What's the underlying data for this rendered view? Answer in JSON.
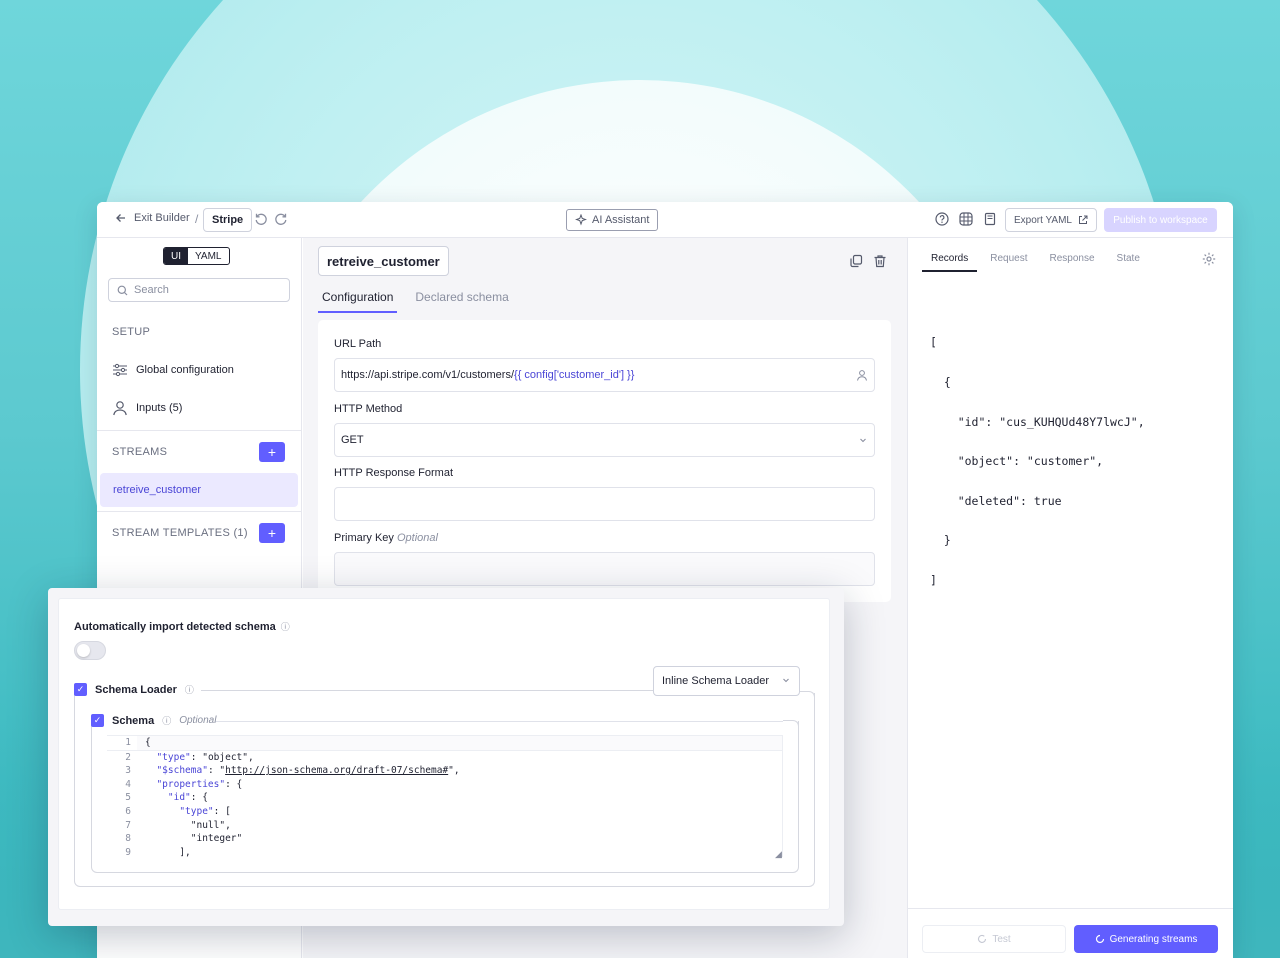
{
  "topbar": {
    "exit_label": "Exit Builder",
    "separator": "/",
    "connector_name": "Stripe",
    "ai_label": "AI Assistant",
    "export_label": "Export YAML",
    "publish_label": "Publish to workspace"
  },
  "sidebar": {
    "modes": [
      "UI",
      "YAML"
    ],
    "search_placeholder": "Search",
    "setup_label": "SETUP",
    "global_config": "Global configuration",
    "inputs": "Inputs (5)",
    "streams_label": "STREAMS",
    "selected_stream": "retreive_customer",
    "templates_label": "STREAM TEMPLATES (1)",
    "plus": "+"
  },
  "main": {
    "stream_name": "retreive_customer",
    "tabs": [
      "Configuration",
      "Declared schema"
    ],
    "url_label": "URL Path",
    "url_prefix": "https://api.stripe.com/v1/customers/",
    "url_template": "{{ config['customer_id'] }}",
    "method_label": "HTTP Method",
    "method_value": "GET",
    "format_label": "HTTP Response Format",
    "pk_label": "Primary Key",
    "optional": "Optional"
  },
  "right_panel": {
    "tabs": [
      "Records",
      "Request",
      "Response",
      "State"
    ],
    "records_lines": [
      "[",
      "  {",
      "    \"id\": \"cus_KUHQUd48Y7lwcJ\",",
      "    \"object\": \"customer\",",
      "    \"deleted\": true",
      "  }",
      "]"
    ],
    "test_label": "Test",
    "generate_label": "Generating streams"
  },
  "popup": {
    "auto_import_label": "Automatically import detected schema",
    "info_glyph": "ⓘ",
    "schema_loader_label": "Schema Loader",
    "loader_value": "Inline Schema Loader",
    "schema_label": "Schema",
    "optional": "Optional",
    "code": [
      {
        "n": "1",
        "t": "{"
      },
      {
        "n": "2",
        "k": "\"type\"",
        "r": ": \"object\","
      },
      {
        "n": "3",
        "k": "\"$schema\"",
        "r": ": \"",
        "u": "http://json-schema.org/draft-07/schema#",
        "r2": "\","
      },
      {
        "n": "4",
        "k": "\"properties\"",
        "r": ": {"
      },
      {
        "n": "5",
        "k": "\"id\"",
        "r": ": {"
      },
      {
        "n": "6",
        "k": "\"type\"",
        "r": ": ["
      },
      {
        "n": "7",
        "t": "\"null\","
      },
      {
        "n": "8",
        "t": "\"integer\""
      },
      {
        "n": "9",
        "t": "],"
      }
    ]
  },
  "colors": {
    "accent": "#615eff",
    "accent_light": "#ebe9ff",
    "publish_disabled": "#d8d4ff"
  }
}
